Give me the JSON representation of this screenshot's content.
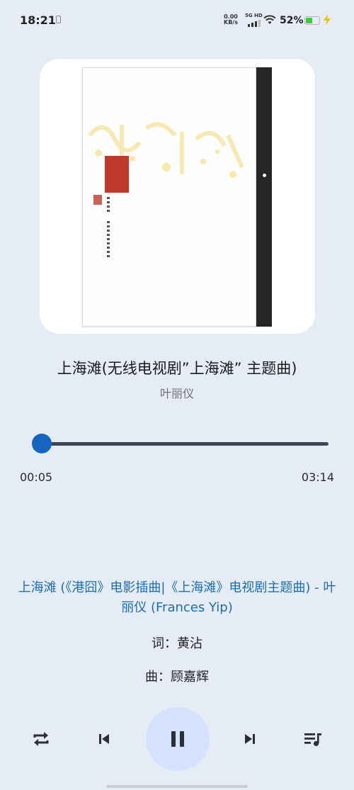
{
  "status_bar": {
    "time": "18:21",
    "net_speed": "0.00",
    "net_unit": "KB/s",
    "net_type": "5G HD",
    "battery": "52%",
    "battery_level": 0.52
  },
  "player": {
    "title": "上海滩(无线电视剧”上海滩” 主题曲)",
    "artist": "叶丽仪",
    "elapsed": "00:05",
    "duration": "03:14",
    "progress": 0.027
  },
  "lyrics": {
    "current": "上海滩 (《港囧》电影插曲|《上海滩》电视剧主题曲) - 叶丽仪 (Frances Yip)",
    "lines": [
      "词：黄沾",
      "曲：顾嘉辉"
    ]
  },
  "controls": {
    "repeat_icon": "repeat-icon",
    "prev_icon": "skip-previous-icon",
    "play_state_icon": "pause-icon",
    "next_icon": "skip-next-icon",
    "queue_icon": "queue-music-icon"
  },
  "colors": {
    "accent": "#1565c0",
    "lyric_active": "#1a6eb0",
    "background": "#e6ecf6"
  }
}
